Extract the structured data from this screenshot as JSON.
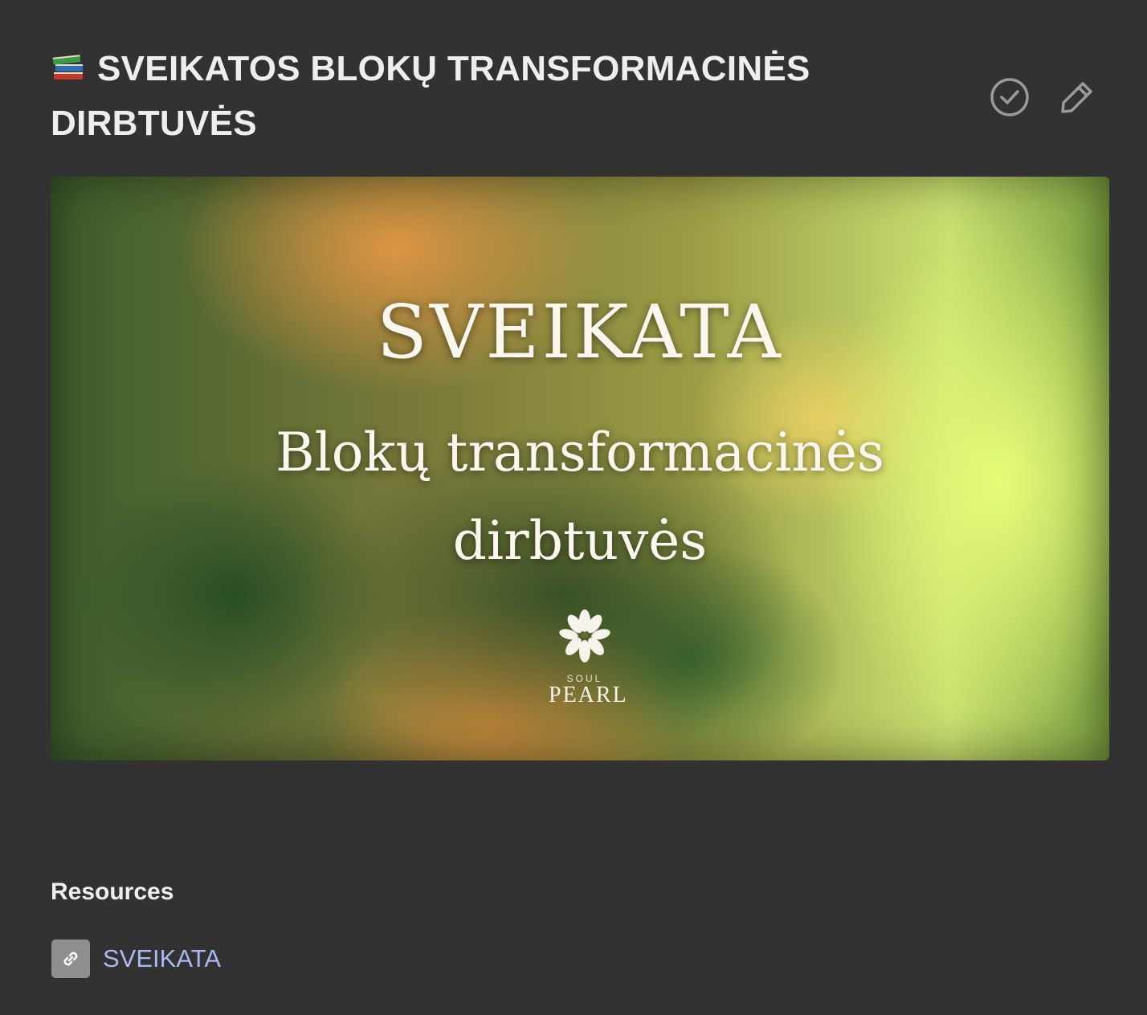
{
  "header": {
    "emoji": "books-emoji",
    "title_line1": "SVEIKATOS BLOKŲ TRANSFORMACINĖS",
    "title_line2": "DIRBTUVĖS"
  },
  "actions": [
    {
      "icon": "check-circle-icon"
    },
    {
      "icon": "pencil-icon"
    }
  ],
  "hero": {
    "line1": "SVEIKATA",
    "line2": "Blokų transformacinės",
    "line3": "dirbtuvės",
    "logo_small": "SOUL",
    "logo_brand": "PEARL"
  },
  "resources": {
    "title": "Resources",
    "items": [
      {
        "icon": "link-icon",
        "label": "SVEIKATA"
      }
    ]
  },
  "colors": {
    "background": "#323232",
    "link": "#a8b8f0",
    "icon_gray": "#8e8e8e"
  }
}
